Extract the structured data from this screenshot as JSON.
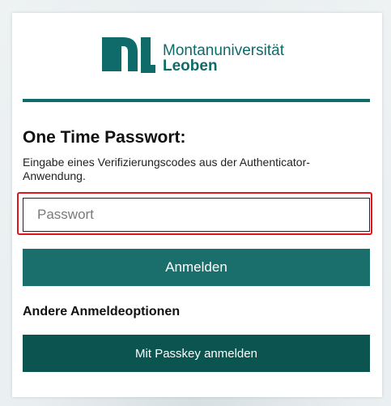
{
  "brand": {
    "name_line1": "Montanuniversität",
    "name_line2": "Leoben",
    "color": "#0e6b69",
    "logo_icon": "mul-logo-icon"
  },
  "form": {
    "title": "One Time Passwort:",
    "description": "Eingabe eines Verifizierungscodes aus der Authenticator-Anwendung.",
    "otp_input": {
      "placeholder": "Passwort",
      "value": ""
    },
    "submit_label": "Anmelden"
  },
  "other_options": {
    "heading": "Andere Anmeldeoptionen",
    "passkey_label": "Mit Passkey anmelden"
  },
  "colors": {
    "primary_button": "#1a6e6c",
    "secondary_button": "#0b5450",
    "focus_ring": "#e0161f"
  }
}
